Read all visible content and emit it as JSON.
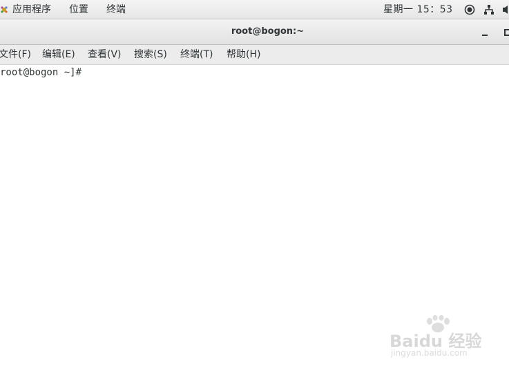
{
  "top_panel": {
    "menus": [
      "应用程序",
      "位置",
      "终端"
    ],
    "clock": "星期一 15：53",
    "tray_icons": [
      "accessibility-icon",
      "network-icon",
      "volume-icon"
    ]
  },
  "window": {
    "title": "root@bogon:~",
    "minimize_label": "–"
  },
  "menu_bar": {
    "items": [
      "文件(F)",
      "编辑(E)",
      "查看(V)",
      "搜索(S)",
      "终端(T)",
      "帮助(H)"
    ]
  },
  "terminal": {
    "prompt": "root@bogon ~]# "
  },
  "watermark": {
    "brand": "Baidu 经验",
    "url": "jingyan.baidu.com"
  }
}
